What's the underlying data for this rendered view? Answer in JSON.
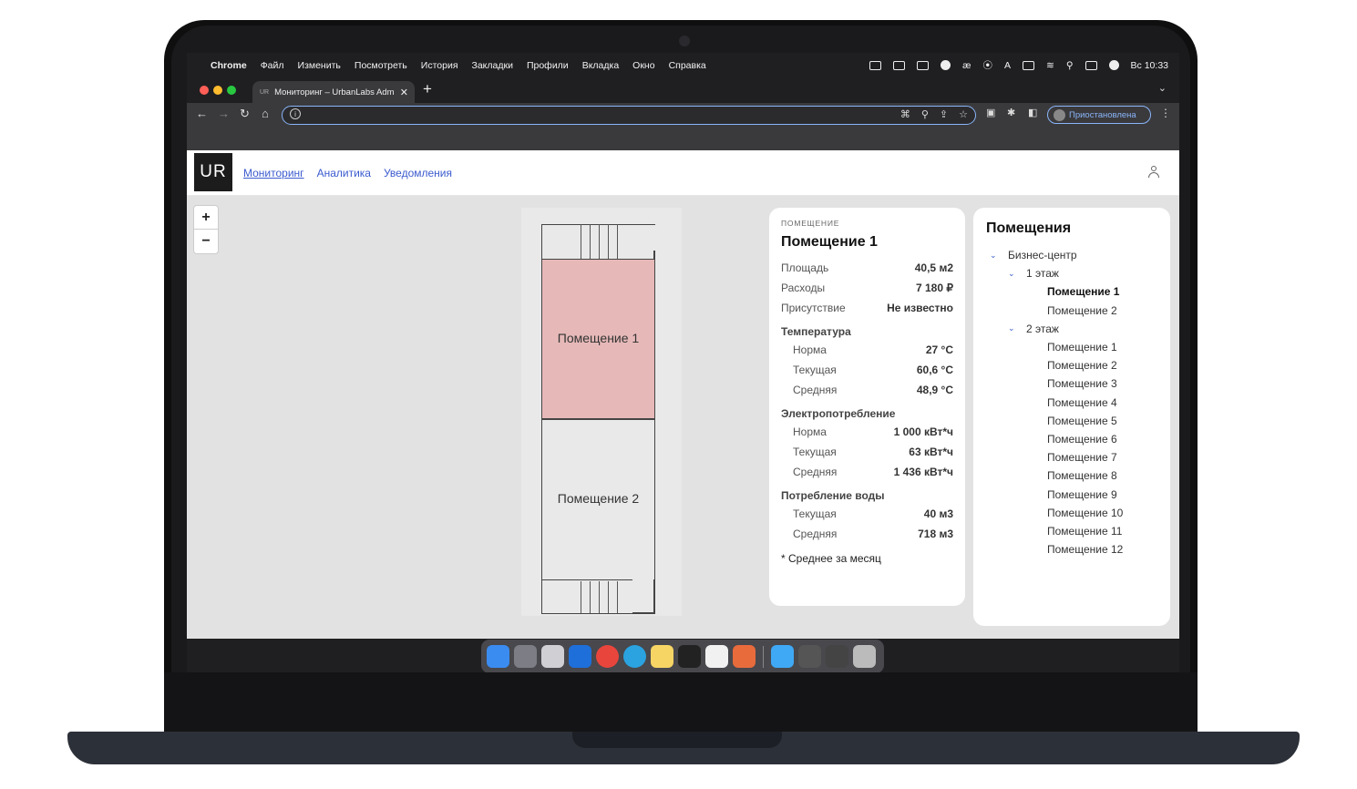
{
  "menubar": {
    "apple_icon": "apple-icon",
    "app_name": "Chrome",
    "items": [
      "Файл",
      "Изменить",
      "Посмотреть",
      "История",
      "Закладки",
      "Профили",
      "Вкладка",
      "Окно",
      "Справка"
    ],
    "clock": "Вс 10:33"
  },
  "browser": {
    "tab_title": "Мониторинг – UrbanLabs Adm",
    "tab_favicon": "UR",
    "new_tab": "+",
    "profile_status": "Приостановлена"
  },
  "app": {
    "logo": "UR",
    "nav": [
      "Мониторинг",
      "Аналитика",
      "Уведомления"
    ],
    "zoom_in": "+",
    "zoom_out": "−",
    "plan": {
      "room1_label": "Помещение 1",
      "room2_label": "Помещение 2",
      "room1_color": "#e6b9b8"
    },
    "details": {
      "overline": "ПОМЕЩЕНИЕ",
      "title": "Помещение 1",
      "summary": [
        {
          "label": "Площадь",
          "value": "40,5 м2"
        },
        {
          "label": "Расходы",
          "value": "7 180 ₽"
        },
        {
          "label": "Присутствие",
          "value": "Не известно"
        }
      ],
      "temperature": {
        "title": "Температура",
        "rows": [
          {
            "label": "Норма",
            "value": "27 °C"
          },
          {
            "label": "Текущая",
            "value": "60,6 °C"
          },
          {
            "label": "Средняя",
            "value": "48,9 °C"
          }
        ]
      },
      "electricity": {
        "title": "Электропотребление",
        "rows": [
          {
            "label": "Норма",
            "value": "1 000 кВт*ч"
          },
          {
            "label": "Текущая",
            "value": "63 кВт*ч"
          },
          {
            "label": "Средняя",
            "value": "1 436 кВт*ч"
          }
        ]
      },
      "water": {
        "title": "Потребление воды",
        "rows": [
          {
            "label": "Текущая",
            "value": "40 м3"
          },
          {
            "label": "Средняя",
            "value": "718 м3"
          }
        ]
      },
      "note": "* Среднее за месяц"
    },
    "rooms_panel": {
      "title": "Помещения",
      "building": "Бизнес-центр",
      "floor1": "1 этаж",
      "floor1_rooms": [
        "Помещение 1",
        "Помещение 2"
      ],
      "floor2": "2 этаж",
      "floor2_rooms": [
        "Помещение 1",
        "Помещение 2",
        "Помещение 3",
        "Помещение 4",
        "Помещение 5",
        "Помещение 6",
        "Помещение 7",
        "Помещение 8",
        "Помещение 9",
        "Помещение 10",
        "Помещение 11",
        "Помещение 12"
      ]
    },
    "accent_color": "#3b5bcf"
  }
}
